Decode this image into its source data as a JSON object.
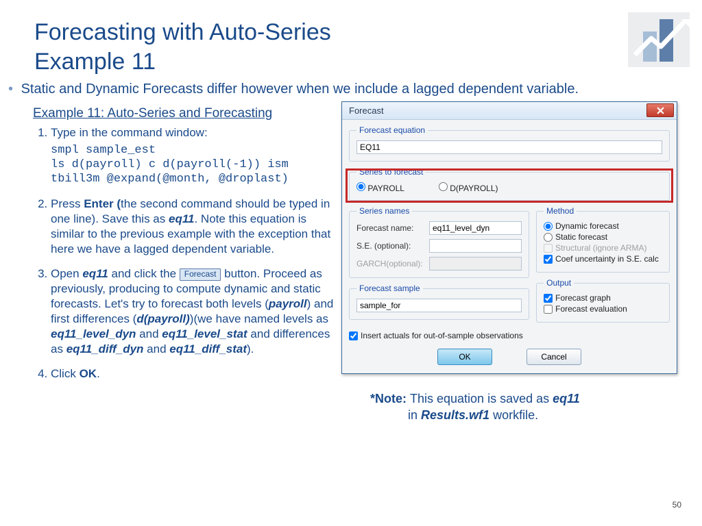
{
  "title_line1": "Forecasting with Auto-Series",
  "title_line2": "Example 11",
  "subtitle": "Static and Dynamic Forecasts differ however when we include a lagged dependent variable.",
  "section_title": "Example 11: Auto-Series and Forecasting",
  "steps": {
    "s1_intro": "Type in the command window:",
    "cmd": "smpl sample_est\nls d(payroll) c d(payroll(-1)) ism\ntbill3m @expand(@month, @droplast)",
    "s2_a": "Press ",
    "s2_enter": "Enter (",
    "s2_b": "the second command should be typed in one line). Save this as ",
    "s2_eq11": "eq11",
    "s2_c": ". Note this equation is similar to the previous example with the exception that here we have a lagged dependent variable.",
    "s3_a": "Open ",
    "s3_eq11": "eq11",
    "s3_b": " and click the ",
    "s3_forecast_btn": "Forecast",
    "s3_c": " button. Proceed as previously, producing to compute dynamic and static forecasts. Let's try to forecast both levels (",
    "s3_payroll": "payroll",
    "s3_d": ") and first differences (",
    "s3_dpayroll": "d(payroll)",
    "s3_e": ")(we have named levels as ",
    "s3_n1": "eq11_level_dyn",
    "s3_and1": " and ",
    "s3_n2": "eq11_level_stat",
    "s3_and2": " and differences as ",
    "s3_n3": "eq11_diff_dyn",
    "s3_and3": " and ",
    "s3_n4": "eq11_diff_stat",
    "s3_f": ").",
    "s4_a": "Click ",
    "s4_ok": "OK",
    "s4_b": "."
  },
  "dialog": {
    "title": "Forecast",
    "equation_legend": "Forecast equation",
    "equation_value": "EQ11",
    "series_legend": "Series to forecast",
    "radio_payroll": "PAYROLL",
    "radio_dpayroll": "D(PAYROLL)",
    "names_legend": "Series names",
    "forecast_name_label": "Forecast name:",
    "forecast_name_value": "eq11_level_dyn",
    "se_label": "S.E. (optional):",
    "se_value": "",
    "garch_label": "GARCH(optional):",
    "garch_value": "",
    "method_legend": "Method",
    "method_dynamic": "Dynamic forecast",
    "method_static": "Static forecast",
    "method_structural": "Structural (ignore ARMA)",
    "method_coef": "Coef uncertainty in S.E. calc",
    "sample_legend": "Forecast sample",
    "sample_value": "sample_for",
    "output_legend": "Output",
    "output_graph": "Forecast graph",
    "output_eval": "Forecast evaluation",
    "insert_actuals": "Insert actuals for out-of-sample observations",
    "ok": "OK",
    "cancel": "Cancel"
  },
  "note": {
    "prefix": "*Note: ",
    "text1": "This equation is saved as ",
    "eq": "eq11",
    "text2": " in ",
    "file": "Results.wf1",
    "text3": " workfile."
  },
  "page_num": "50"
}
